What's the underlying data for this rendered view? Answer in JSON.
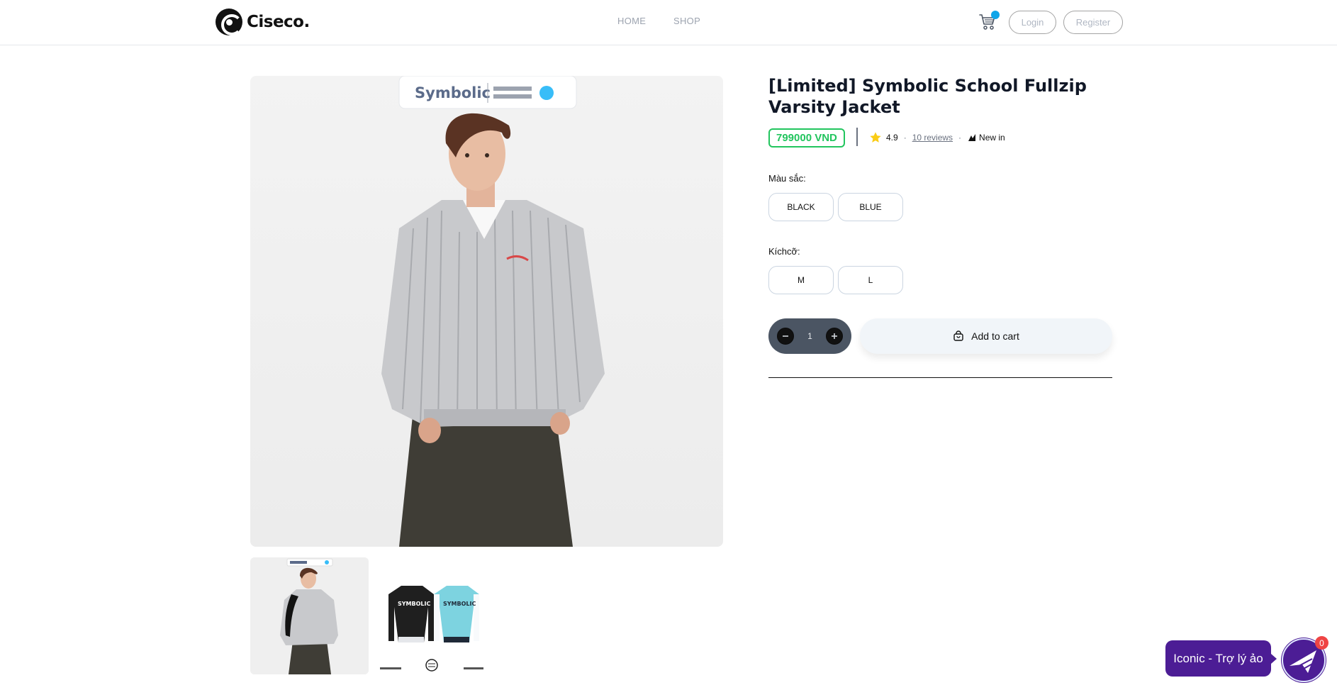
{
  "header": {
    "logo_text": "Ciseco.",
    "nav": [
      "HOME",
      "SHOP"
    ],
    "login_label": "Login",
    "register_label": "Register"
  },
  "product": {
    "title": "[Limited] Symbolic School Fullzip Varsity Jacket",
    "price": "799000 VND",
    "rating": "4.9",
    "reviews": "10 reviews",
    "badge": "New in",
    "color_label": "Màu sắc:",
    "colors": [
      "BLACK",
      "BLUE"
    ],
    "size_label": "Kíchcỡ:",
    "sizes": [
      "M",
      "L"
    ],
    "quantity": "1",
    "add_to_cart_label": "Add to cart"
  },
  "chat": {
    "label": "Iconic - Trợ lý ảo",
    "badge_count": "0"
  },
  "colors": {
    "price_green": "#22c55e",
    "cart_dot": "#0ea5e9",
    "chat_purple": "#4c1d95",
    "badge_red": "#ef4444",
    "star": "#facc15"
  },
  "icons": [
    "logo-icon",
    "cart-icon",
    "star-icon",
    "new-in-icon",
    "minus-icon",
    "plus-icon",
    "shopping-bag-icon",
    "chat-bot-icon"
  ]
}
